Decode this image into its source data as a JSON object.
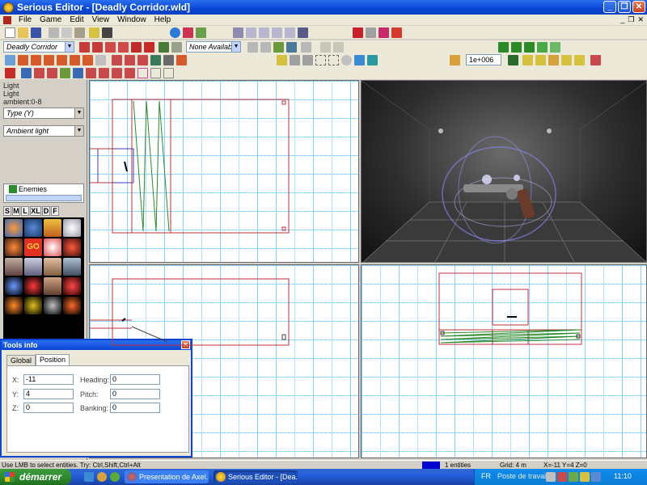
{
  "window": {
    "title": "Serious Editor - [Deadly Corridor.wld]"
  },
  "menu": {
    "items": [
      "File",
      "Game",
      "Edit",
      "View",
      "Window",
      "Help"
    ]
  },
  "toolbar": {
    "world_combo": "Deadly Corridor",
    "layer_combo": "None Available",
    "value_field": "1e+006"
  },
  "properties": {
    "line1": "Light",
    "line2": "Light",
    "line3": "ambient:0-8",
    "type_combo": "Type (Y)",
    "light_combo": "Ambient light"
  },
  "browser": {
    "tree_item": "Enemies",
    "size_tabs": [
      "S",
      "M",
      "L",
      "XL",
      "D",
      "F"
    ]
  },
  "tools_info": {
    "title": "Tools info",
    "tabs": [
      "Global",
      "Position"
    ],
    "x_label": "X:",
    "y_label": "Y:",
    "z_label": "Z:",
    "x_value": "-11",
    "y_value": "4",
    "z_value": "0",
    "heading_label": "Heading:",
    "pitch_label": "Pitch:",
    "banking_label": "Banking:",
    "heading_value": "0",
    "pitch_value": "0",
    "banking_value": "0"
  },
  "status": {
    "hint": "Use LMB to select entities. Try: Ctrl,Shift,Ctrl+Alt",
    "entities": "1 entities",
    "grid": "Grid: 4 m",
    "coords": "X=-11 Y=4 Z=0"
  },
  "taskbar": {
    "start": "démarrer",
    "task1": "Presentation de Axel...",
    "task2": "Serious Editor - [Dea...",
    "lang": "FR",
    "desktop": "Poste de travail",
    "clock": "11:10"
  }
}
